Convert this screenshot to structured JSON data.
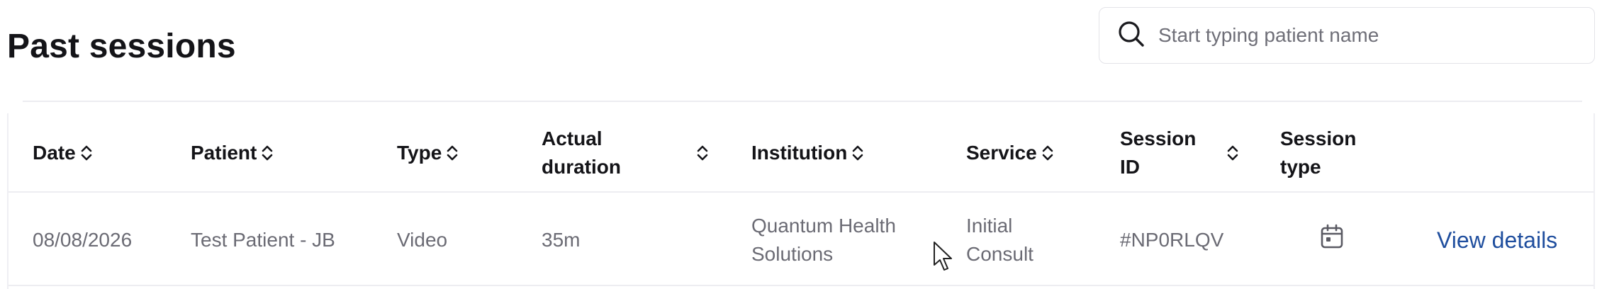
{
  "page": {
    "title": "Past sessions"
  },
  "search": {
    "placeholder": "Start typing patient name",
    "icon": "search-icon"
  },
  "table": {
    "columns": [
      {
        "key": "date",
        "label": "Date",
        "sortable": true
      },
      {
        "key": "patient",
        "label": "Patient",
        "sortable": true
      },
      {
        "key": "type",
        "label": "Type",
        "sortable": true
      },
      {
        "key": "actual_duration",
        "label": "Actual\nduration",
        "sortable": true
      },
      {
        "key": "institution",
        "label": "Institution",
        "sortable": true
      },
      {
        "key": "service",
        "label": "Service",
        "sortable": true
      },
      {
        "key": "session_id",
        "label": "Session\nID",
        "sortable": true
      },
      {
        "key": "session_type",
        "label": "Session\ntype",
        "sortable": false
      }
    ],
    "rows": [
      {
        "date": "08/08/2026",
        "patient": "Test Patient - JB",
        "type": "Video",
        "actual_duration": "35m",
        "institution": "Quantum Health\nSolutions",
        "service": "Initial\nConsult",
        "session_id": "#NP0RLQV",
        "session_type_icon": "calendar-icon",
        "action_label": "View details"
      }
    ]
  },
  "colors": {
    "text_primary": "#141418",
    "text_muted": "#6b6b74",
    "link": "#1f4e9e",
    "border": "#ededf1"
  }
}
